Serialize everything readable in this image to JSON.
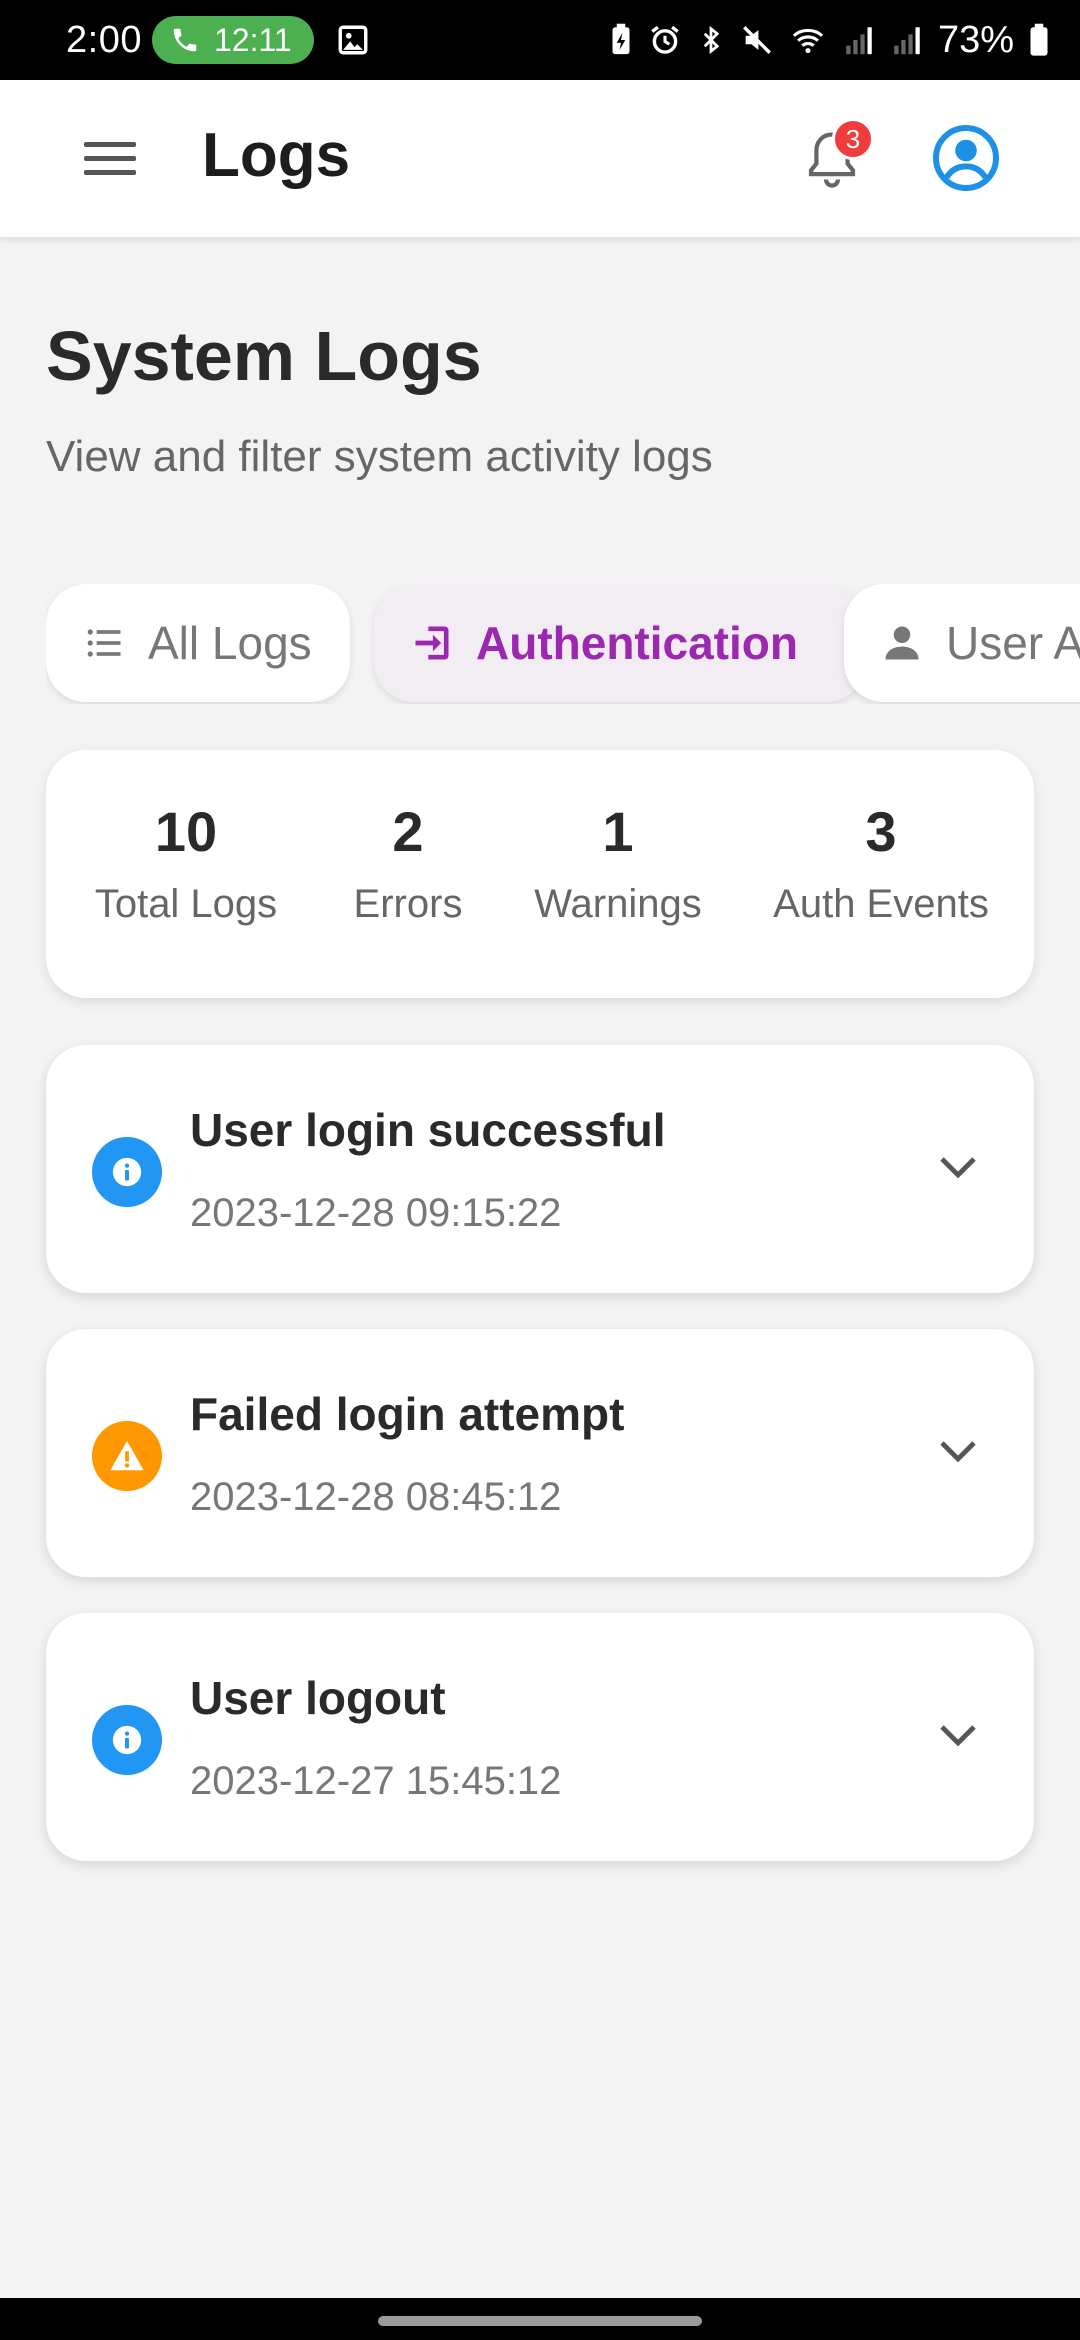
{
  "status_bar": {
    "time": "2:00",
    "call_timer": "12:11",
    "battery_percent": "73%",
    "icons": [
      "phone-icon",
      "gallery-icon",
      "battery-saver-icon",
      "alarm-icon",
      "bluetooth-icon",
      "mute-icon",
      "wifi-icon",
      "signal-icon",
      "signal-icon",
      "battery-icon"
    ]
  },
  "app_bar": {
    "title": "Logs",
    "notification_count": "3"
  },
  "page": {
    "title": "System Logs",
    "subtitle": "View and filter system activity logs"
  },
  "filters": [
    {
      "label": "All Logs",
      "icon": "list-icon",
      "selected": false
    },
    {
      "label": "Authentication",
      "icon": "login-icon",
      "selected": true
    },
    {
      "label": "User A",
      "icon": "person-icon",
      "selected": false
    }
  ],
  "stats": [
    {
      "value": "10",
      "label": "Total Logs"
    },
    {
      "value": "2",
      "label": "Errors"
    },
    {
      "value": "1",
      "label": "Warnings"
    },
    {
      "value": "3",
      "label": "Auth Events"
    }
  ],
  "logs": [
    {
      "title": "User login successful",
      "timestamp": "2023-12-28 09:15:22",
      "level": "info"
    },
    {
      "title": "Failed login attempt",
      "timestamp": "2023-12-28 08:45:12",
      "level": "warning"
    },
    {
      "title": "User logout",
      "timestamp": "2023-12-27 15:45:12",
      "level": "info"
    }
  ],
  "colors": {
    "accent": "#9c27b0",
    "info": "#2196f3",
    "warning": "#ff9800",
    "badge": "#f23b3b",
    "call": "#4caf50"
  }
}
